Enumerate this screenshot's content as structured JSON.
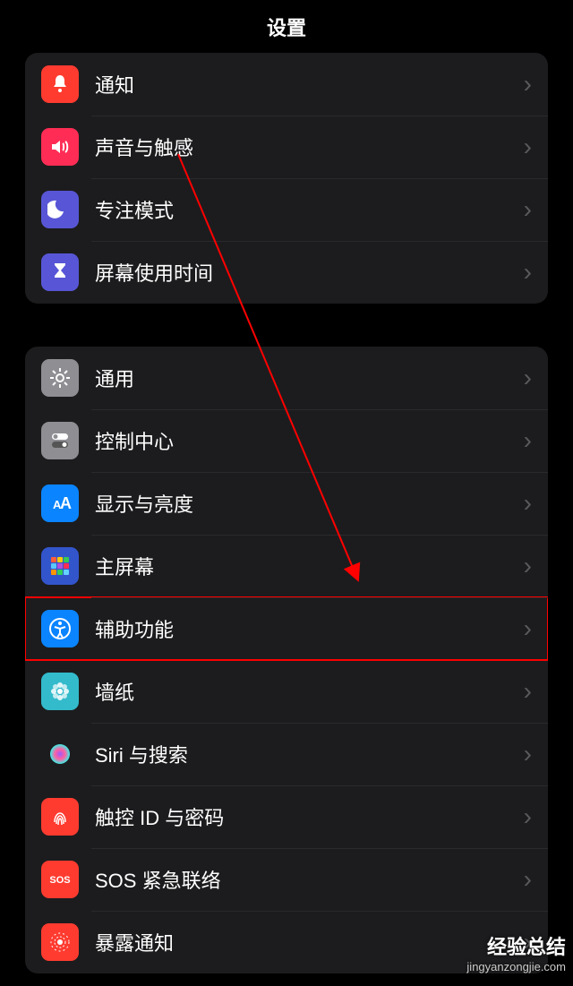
{
  "header": {
    "title": "设置"
  },
  "groups": [
    {
      "items": [
        {
          "name": "notifications",
          "label": "通知",
          "icon": "bell-icon",
          "bg": "#ff3b30"
        },
        {
          "name": "sounds",
          "label": "声音与触感",
          "icon": "speaker-icon",
          "bg": "#ff2d55"
        },
        {
          "name": "focus",
          "label": "专注模式",
          "icon": "moon-icon",
          "bg": "#5856d6"
        },
        {
          "name": "screen-time",
          "label": "屏幕使用时间",
          "icon": "hourglass-icon",
          "bg": "#5856d6"
        }
      ]
    },
    {
      "items": [
        {
          "name": "general",
          "label": "通用",
          "icon": "gear-icon",
          "bg": "#8e8e93"
        },
        {
          "name": "control-center",
          "label": "控制中心",
          "icon": "switches-icon",
          "bg": "#8e8e93"
        },
        {
          "name": "display",
          "label": "显示与亮度",
          "icon": "text-size-icon",
          "bg": "#0a84ff"
        },
        {
          "name": "home-screen",
          "label": "主屏幕",
          "icon": "apps-grid-icon",
          "bg": "#3355cc"
        },
        {
          "name": "accessibility",
          "label": "辅助功能",
          "icon": "accessibility-icon",
          "bg": "#0a84ff",
          "highlighted": true
        },
        {
          "name": "wallpaper",
          "label": "墙纸",
          "icon": "flower-icon",
          "bg": "#33bbcc"
        },
        {
          "name": "siri",
          "label": "Siri 与搜索",
          "icon": "siri-icon",
          "bg": "#1c1c1e"
        },
        {
          "name": "touchid",
          "label": "触控 ID 与密码",
          "icon": "fingerprint-icon",
          "bg": "#ff3b30"
        },
        {
          "name": "sos",
          "label": "SOS 紧急联络",
          "icon": "sos-icon",
          "bg": "#ff3b30"
        },
        {
          "name": "exposure",
          "label": "暴露通知",
          "icon": "exposure-icon",
          "bg": "#ff3b30"
        }
      ]
    }
  ],
  "watermark": {
    "top": "经验总结",
    "bottom": "jingyanzongjie.com"
  }
}
